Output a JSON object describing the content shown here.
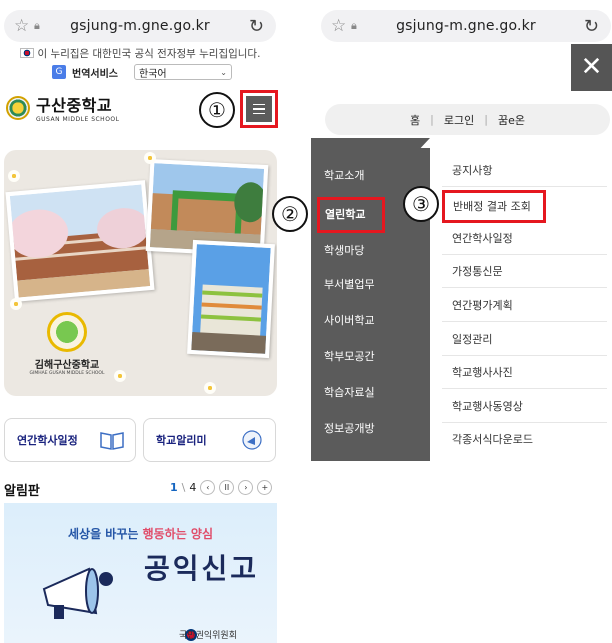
{
  "left": {
    "browser": {
      "url": "gsjung-m.gne.go.kr"
    },
    "gov_notice": "이 누리집은 대한민국 공식 전자정부 누리집입니다.",
    "translate": {
      "label": "번역서비스",
      "language": "한국어"
    },
    "school": {
      "name_ko": "구산중학교",
      "name_en": "GUSAN MIDDLE SCHOOL"
    },
    "hero_badge": {
      "name_ko": "김해구산중학교",
      "name_en": "GIMHAE GUSAN MIDDLE SCHOOL"
    },
    "quick_links": [
      {
        "label": "연간학사일정"
      },
      {
        "label": "학교알리미"
      }
    ],
    "board": {
      "title": "알림판",
      "page_current": "1",
      "page_total": "4"
    },
    "banner": {
      "sub_a": "세상을 바꾸는",
      "sub_b": "행동하는 양심",
      "main": "공익신고",
      "org": "국민권익위원회"
    }
  },
  "right": {
    "browser": {
      "url": "gsjung-m.gne.go.kr"
    },
    "util_links": [
      "홈",
      "로그인",
      "꿈e온"
    ],
    "main_menu": [
      "학교소개",
      "열린학교",
      "학생마당",
      "부서별업무",
      "사이버학교",
      "학부모공간",
      "학습자료실",
      "정보공개방"
    ],
    "active_menu_index": 1,
    "sub_menu": [
      "공지사항",
      "반배정 결과 조회",
      "연간학사일정",
      "가정통신문",
      "연간평가계획",
      "일정관리",
      "학교행사사진",
      "학교행사동영상",
      "각종서식다운로드"
    ],
    "highlight_sub_index": 1
  },
  "markers": {
    "one": "①",
    "two": "②",
    "three": "③"
  },
  "colors": {
    "highlight_red": "#e5171f",
    "nav_gray": "#5b5b5b",
    "link_navy": "#1a237e"
  }
}
